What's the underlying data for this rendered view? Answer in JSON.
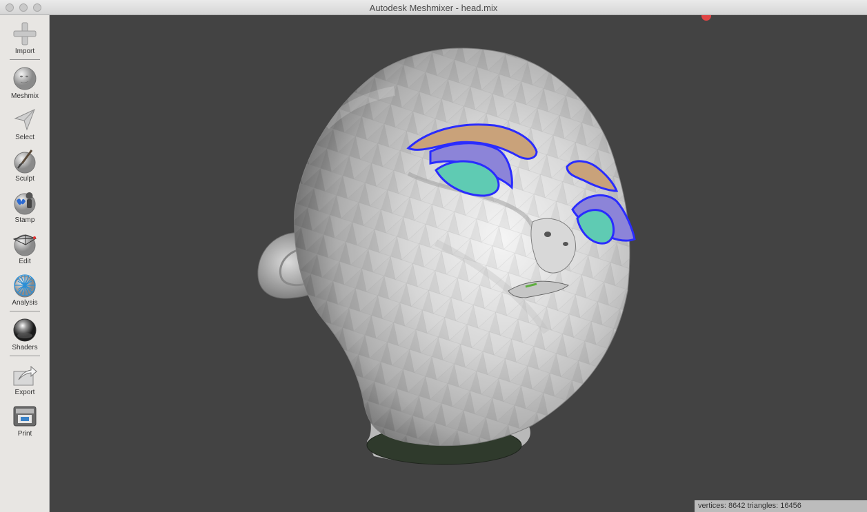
{
  "window": {
    "title": "Autodesk Meshmixer - head.mix"
  },
  "toolbar": {
    "items": [
      {
        "label": "Import",
        "icon": "plus-icon"
      },
      {
        "label": "Meshmix",
        "icon": "meshmix-sphere-icon"
      },
      {
        "label": "Select",
        "icon": "cursor-arrow-icon"
      },
      {
        "label": "Sculpt",
        "icon": "brush-icon"
      },
      {
        "label": "Stamp",
        "icon": "stamp-icon"
      },
      {
        "label": "Edit",
        "icon": "edit-mesh-icon"
      },
      {
        "label": "Analysis",
        "icon": "analysis-mesh-icon"
      },
      {
        "label": "Shaders",
        "icon": "shader-ball-icon"
      },
      {
        "label": "Export",
        "icon": "export-icon"
      },
      {
        "label": "Print",
        "icon": "printer-icon"
      }
    ]
  },
  "viewport": {
    "background_color": "#434343",
    "model": "head mesh",
    "selection_color": "#2222ff"
  },
  "status": {
    "text": "vertices: 8642 triangles: 16456"
  }
}
